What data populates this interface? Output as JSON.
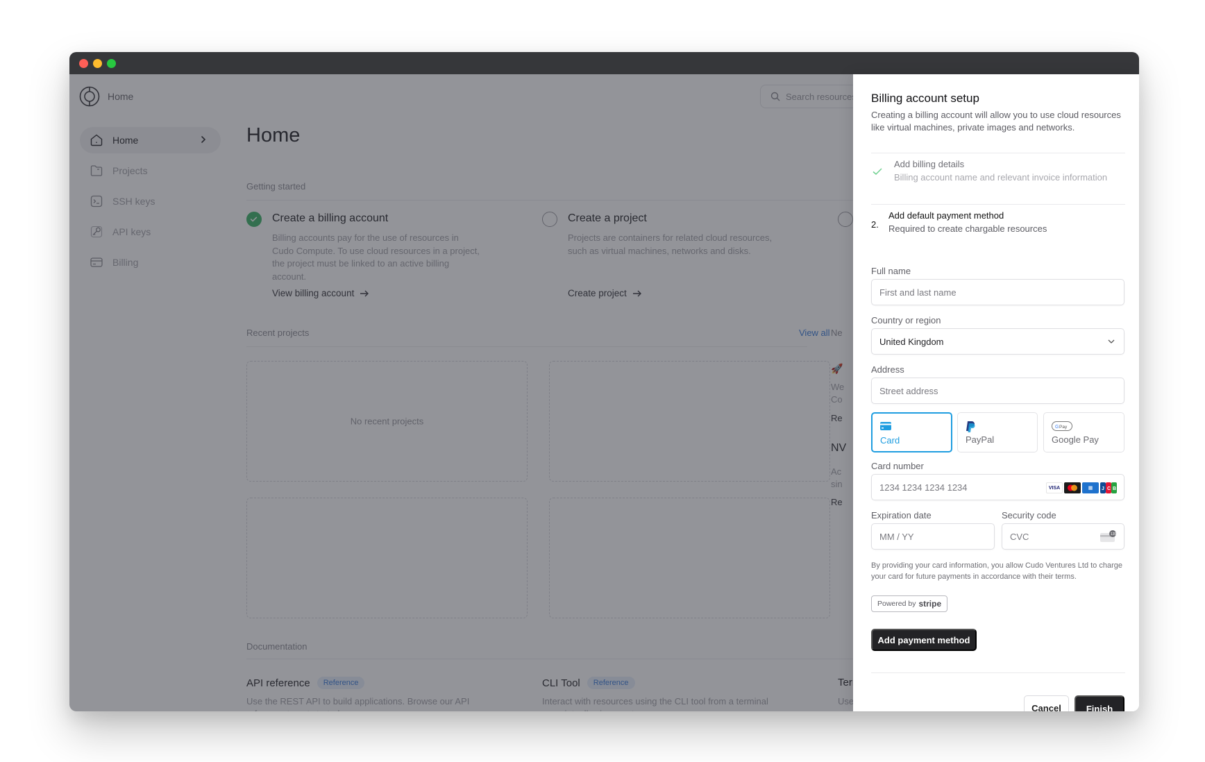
{
  "window": {
    "traffic_lights": [
      "close",
      "minimize",
      "maximize"
    ]
  },
  "topbar": {
    "breadcrumb": "Home",
    "search_placeholder": "Search resources"
  },
  "sidebar": {
    "items": [
      {
        "label": "Home",
        "icon": "home-icon",
        "active": true
      },
      {
        "label": "Projects",
        "icon": "folder-icon",
        "active": false
      },
      {
        "label": "SSH keys",
        "icon": "terminal-icon",
        "active": false
      },
      {
        "label": "API keys",
        "icon": "key-icon",
        "active": false
      },
      {
        "label": "Billing",
        "icon": "credit-card-icon",
        "active": false
      }
    ]
  },
  "main": {
    "title": "Home",
    "getting_started": {
      "label": "Getting started",
      "steps": [
        {
          "title": "Create a billing account",
          "description": "Billing accounts pay for the use of resources in Cudo Compute. To use cloud resources in a project, the project must be linked to an active billing account.",
          "link": "View billing account",
          "done": true
        },
        {
          "title": "Create a project",
          "description": "Projects are containers for related cloud resources, such as virtual machines, networks and disks.",
          "link": "Create project",
          "done": false
        }
      ]
    },
    "recent_projects": {
      "label": "Recent projects",
      "view_all": "View all",
      "empty": "No recent projects"
    },
    "news": {
      "label_fragment": "Ne",
      "fragments": [
        "We",
        "Co",
        "Re",
        "NV",
        "Ac",
        "sin",
        "Re"
      ]
    },
    "documentation": {
      "label": "Documentation",
      "items": [
        {
          "title": "API reference",
          "badge": "Reference",
          "description": "Use the REST API to build applications. Browse our API reference to get started."
        },
        {
          "title": "CLI Tool",
          "badge": "Reference",
          "description": "Interact with resources using the CLI tool from a terminal or script, allowing you to manage your"
        },
        {
          "title": "Terr",
          "badge": "",
          "description": "Use reso"
        }
      ]
    }
  },
  "panel": {
    "title": "Billing account setup",
    "subtitle": "Creating a billing account will allow you to use cloud resources like virtual machines, private images and networks.",
    "steps": [
      {
        "marker": "check",
        "title": "Add billing details",
        "description": "Billing account name and relevant invoice information",
        "state": "complete"
      },
      {
        "marker": "2.",
        "title": "Add default payment method",
        "description": "Required to create chargable resources",
        "state": "current"
      }
    ],
    "form": {
      "full_name": {
        "label": "Full name",
        "placeholder": "First and last name",
        "value": ""
      },
      "country": {
        "label": "Country or region",
        "value": "United Kingdom"
      },
      "address": {
        "label": "Address",
        "placeholder": "Street address",
        "value": ""
      },
      "payment_methods": [
        {
          "label": "Card",
          "icon": "card-icon",
          "selected": true
        },
        {
          "label": "PayPal",
          "icon": "paypal-icon",
          "selected": false
        },
        {
          "label": "Google Pay",
          "icon": "google-pay-icon",
          "selected": false
        }
      ],
      "card_number": {
        "label": "Card number",
        "placeholder": "1234 1234 1234 1234",
        "brands": [
          "VISA",
          "Mastercard",
          "AMEX",
          "JCB"
        ]
      },
      "expiration": {
        "label": "Expiration date",
        "placeholder": "MM / YY"
      },
      "security_code": {
        "label": "Security code",
        "placeholder": "CVC"
      },
      "legal": "By providing your card information, you allow Cudo Ventures Ltd to charge your card for future payments in accordance with their terms.",
      "powered_by": "Powered by",
      "powered_brand": "stripe",
      "submit_label": "Add payment method"
    },
    "footer": {
      "cancel_label": "Cancel",
      "finish_label": "Finish"
    }
  },
  "colors": {
    "accent_blue": "#1e9de0",
    "success_green": "#3fb56a",
    "dark_button": "#232326",
    "titlebar": "#36373a",
    "link_blue": "#3d7dd8"
  }
}
